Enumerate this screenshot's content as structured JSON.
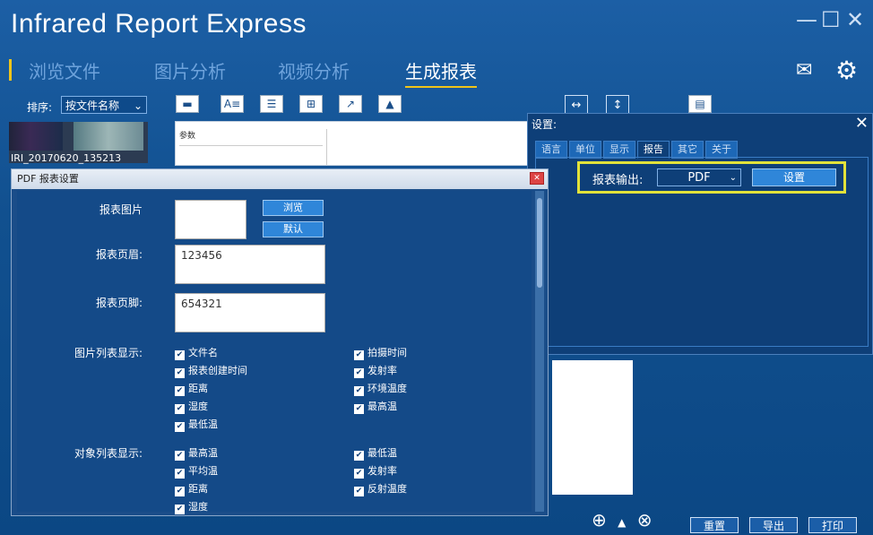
{
  "app": {
    "title": "Infrared Report Express",
    "window_controls": [
      "—",
      "☐",
      "✕"
    ]
  },
  "nav": {
    "tabs": [
      "浏览文件",
      "图片分析",
      "视频分析",
      "生成报表"
    ],
    "active": "生成报表"
  },
  "sort": {
    "label": "排序:",
    "value": "按文件名称"
  },
  "thumbnail": {
    "caption": "IRI_20170620_135213"
  },
  "params_panel": {
    "header": "参数"
  },
  "bottom": {
    "buttons": [
      "重置",
      "导出",
      "打印"
    ],
    "controls": [
      "⊕",
      "▲",
      "⊗"
    ]
  },
  "settings": {
    "title": "设置:",
    "tabs": [
      "语言",
      "单位",
      "显示",
      "报告",
      "其它",
      "关于"
    ],
    "active_tab": "报告",
    "report_output_label": "报表输出:",
    "report_output_value": "PDF",
    "setup_button": "设置"
  },
  "pdf_dialog": {
    "title": "PDF 报表设置",
    "report_image_label": "报表图片",
    "browse_button": "浏览",
    "default_button": "默认",
    "header_label": "报表页眉:",
    "header_value": "123456",
    "footer_label": "报表页脚:",
    "footer_value": "654321",
    "image_list_label": "图片列表显示:",
    "image_list_left": [
      "文件名",
      "报表创建时间",
      "距离",
      "湿度",
      "最低温"
    ],
    "image_list_right": [
      "拍摄时间",
      "发射率",
      "环境温度",
      "最高温"
    ],
    "object_list_label": "对象列表显示:",
    "object_list_left": [
      "最高温",
      "平均温",
      "距离",
      "湿度"
    ],
    "object_list_right": [
      "最低温",
      "发射率",
      "反射温度"
    ]
  },
  "colors": {
    "accent": "#f0c419",
    "highlight": "#e2e23a",
    "background": "#11508f"
  }
}
